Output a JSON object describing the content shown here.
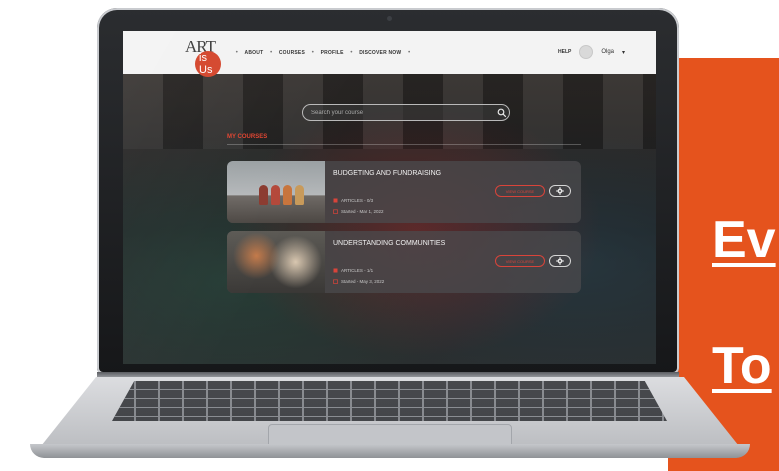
{
  "promo": {
    "line1": "Ev",
    "line2": "To",
    "color": "#e5531d"
  },
  "navbar": {
    "logo_text": "ART",
    "logo_subtext": "is Us",
    "links": [
      "ABOUT",
      "COURSES",
      "PROFILE",
      "DISCOVER NOW"
    ],
    "help": "HELP",
    "user_name": "Olga",
    "caret": "▾"
  },
  "search": {
    "placeholder": "Search your course"
  },
  "my_courses": {
    "heading": "MY COURSES",
    "view_label": "VIEW COURSE",
    "items": [
      {
        "title": "BUDGETING AND FUNDRAISING",
        "progress": "ARTICLES - 0/3",
        "date": "Started - Mar 1, 2022",
        "thumb_icon": "pawn-figures-photo"
      },
      {
        "title": "UNDERSTANDING COMMUNITIES",
        "progress": "ARTICLES - 1/1",
        "date": "Started - May 3, 2022",
        "thumb_icon": "group-meeting-photo"
      }
    ]
  },
  "colors": {
    "accent": "#e0432f",
    "promo": "#e5531d",
    "navbar": "#f3f3f3"
  }
}
